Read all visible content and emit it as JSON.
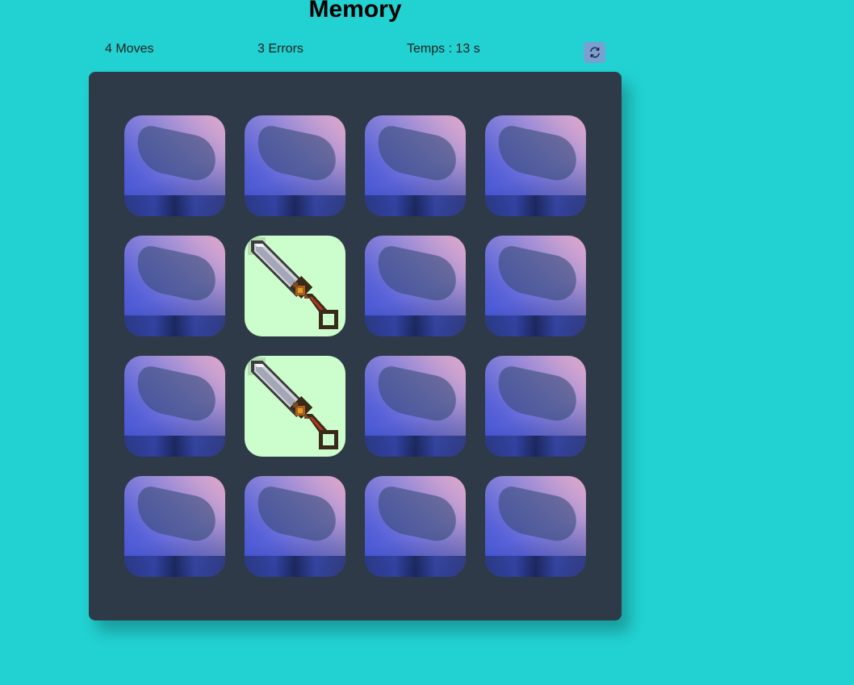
{
  "title": "Memory",
  "stats": {
    "moves": "4 Moves",
    "errors": "3 Errors",
    "timer": "Temps : 13 s"
  },
  "reset_icon": "refresh-icon",
  "colors": {
    "background": "#22d1d1",
    "board": "#2e3a48",
    "card_face": "#ccfdcc",
    "reset_button": "#7a9fd3"
  },
  "cards": [
    {
      "state": "hidden"
    },
    {
      "state": "hidden"
    },
    {
      "state": "hidden"
    },
    {
      "state": "hidden"
    },
    {
      "state": "hidden"
    },
    {
      "state": "revealed",
      "icon": "sword-icon"
    },
    {
      "state": "hidden"
    },
    {
      "state": "hidden"
    },
    {
      "state": "hidden"
    },
    {
      "state": "revealed",
      "icon": "sword-icon"
    },
    {
      "state": "hidden"
    },
    {
      "state": "hidden"
    },
    {
      "state": "hidden"
    },
    {
      "state": "hidden"
    },
    {
      "state": "hidden"
    },
    {
      "state": "hidden"
    }
  ]
}
